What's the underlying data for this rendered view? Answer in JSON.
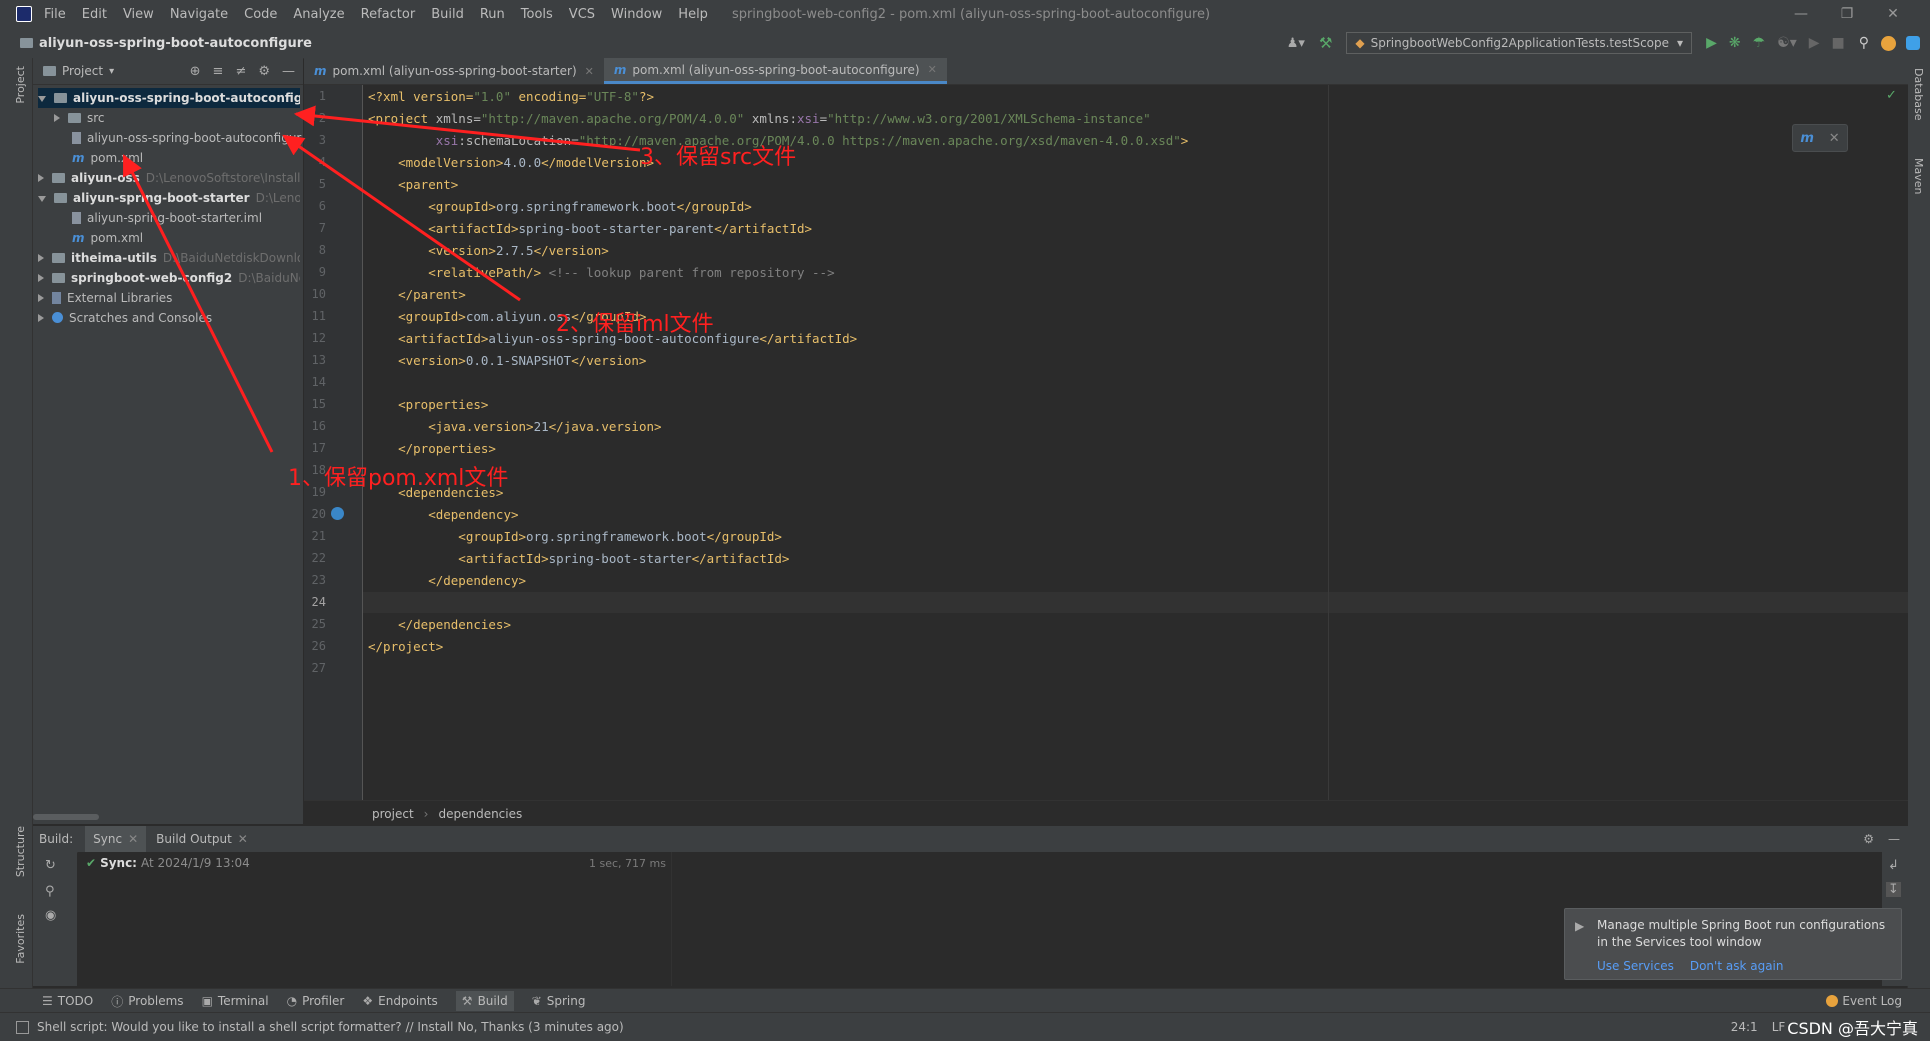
{
  "app": {
    "menu": [
      "File",
      "Edit",
      "View",
      "Navigate",
      "Code",
      "Analyze",
      "Refactor",
      "Build",
      "Run",
      "Tools",
      "VCS",
      "Window",
      "Help"
    ],
    "window_title": "springboot-web-config2 - pom.xml (aliyun-oss-spring-boot-autoconfigure)"
  },
  "navbar": {
    "breadcrumb": "aliyun-oss-spring-boot-autoconfigure",
    "run_config": "SpringbootWebConfig2ApplicationTests.testScope"
  },
  "left_toolbar": {
    "project": "Project",
    "structure": "Structure",
    "favorites": "Favorites"
  },
  "right_toolbar": {
    "database": "Database",
    "maven": "Maven"
  },
  "project_panel": {
    "title": "Project",
    "tree": [
      {
        "label": "aliyun-oss-spring-boot-autoconfigure",
        "path": "",
        "type": "module",
        "expanded": true,
        "indent": 0
      },
      {
        "label": "src",
        "path": "",
        "type": "folder",
        "expanded": false,
        "indent": 1
      },
      {
        "label": "aliyun-oss-spring-boot-autoconfigur",
        "path": "",
        "type": "iml",
        "indent": 2
      },
      {
        "label": "pom.xml",
        "path": "",
        "type": "maven",
        "indent": 2
      },
      {
        "label": "aliyun-oss",
        "path": "D:\\LenovoSoftstore\\Install\\",
        "type": "module",
        "expanded": false,
        "indent": 0
      },
      {
        "label": "aliyun-spring-boot-starter",
        "path": "D:\\LenovoS",
        "type": "module",
        "expanded": true,
        "indent": 0
      },
      {
        "label": "aliyun-spring-boot-starter.iml",
        "path": "",
        "type": "iml",
        "indent": 2
      },
      {
        "label": "pom.xml",
        "path": "",
        "type": "maven",
        "indent": 2
      },
      {
        "label": "itheima-utils",
        "path": "D:\\BaiduNetdiskDownloa",
        "type": "module",
        "expanded": false,
        "indent": 0
      },
      {
        "label": "springboot-web-config2",
        "path": "D:\\BaiduNetc",
        "type": "module",
        "expanded": false,
        "indent": 0
      },
      {
        "label": "External Libraries",
        "path": "",
        "type": "libs",
        "expanded": false,
        "indent": 0
      },
      {
        "label": "Scratches and Consoles",
        "path": "",
        "type": "scratch",
        "expanded": false,
        "indent": 0
      }
    ]
  },
  "tabs": [
    {
      "label": "pom.xml (aliyun-oss-spring-boot-starter)",
      "active": false
    },
    {
      "label": "pom.xml (aliyun-oss-spring-boot-autoconfigure)",
      "active": true
    }
  ],
  "editor": {
    "lines": [
      [
        [
          "<?xml version=",
          "t"
        ],
        [
          "\"1.0\"",
          "s"
        ],
        [
          " encoding=",
          "t"
        ],
        [
          "\"UTF-8\"",
          "s"
        ],
        [
          "?>",
          "t"
        ]
      ],
      [
        [
          "<project ",
          "t"
        ],
        [
          "xmlns=",
          "a"
        ],
        [
          "\"http://maven.apache.org/POM/4.0.0\"",
          "s"
        ],
        [
          " xmlns:",
          "a"
        ],
        [
          "xsi",
          "nsp"
        ],
        [
          "=",
          "a"
        ],
        [
          "\"http://www.w3.org/2001/XMLSchema-instance\"",
          "s"
        ]
      ],
      [
        [
          "         ",
          "a"
        ],
        [
          "xsi",
          "nsp"
        ],
        [
          ":schemaLocation=",
          "a"
        ],
        [
          "\"http://maven.apache.org/POM/4.0.0 https://maven.apache.org/xsd/maven-4.0.0.xsd\"",
          "s"
        ],
        [
          ">",
          "t"
        ]
      ],
      [
        [
          "    <modelVersion>",
          "t"
        ],
        [
          "4.0.0",
          "p"
        ],
        [
          "</modelVersion>",
          "t"
        ]
      ],
      [
        [
          "    <parent>",
          "t"
        ]
      ],
      [
        [
          "        <groupId>",
          "t"
        ],
        [
          "org.springframework.boot",
          "p"
        ],
        [
          "</groupId>",
          "t"
        ]
      ],
      [
        [
          "        <artifactId>",
          "t"
        ],
        [
          "spring-boot-starter-parent",
          "p"
        ],
        [
          "</artifactId>",
          "t"
        ]
      ],
      [
        [
          "        <version>",
          "t"
        ],
        [
          "2.7.5",
          "p"
        ],
        [
          "</version>",
          "t"
        ]
      ],
      [
        [
          "        <relativePath/>",
          "t"
        ],
        [
          " <!-- lookup parent from repository -->",
          "c"
        ]
      ],
      [
        [
          "    </parent>",
          "t"
        ]
      ],
      [
        [
          "    <groupId>",
          "t"
        ],
        [
          "com.aliyun.oss",
          "p"
        ],
        [
          "</groupId>",
          "t"
        ]
      ],
      [
        [
          "    <artifactId>",
          "t"
        ],
        [
          "aliyun-oss-spring-boot-autoconfigure",
          "p"
        ],
        [
          "</artifactId>",
          "t"
        ]
      ],
      [
        [
          "    <version>",
          "t"
        ],
        [
          "0.0.1-SNAPSHOT",
          "p"
        ],
        [
          "</version>",
          "t"
        ]
      ],
      [],
      [
        [
          "    <properties>",
          "t"
        ]
      ],
      [
        [
          "        <java.version>",
          "t"
        ],
        [
          "21",
          "p"
        ],
        [
          "</java.version>",
          "t"
        ]
      ],
      [
        [
          "    </properties>",
          "t"
        ]
      ],
      [],
      [
        [
          "    <dependencies>",
          "t"
        ]
      ],
      [
        [
          "        <dependency>",
          "t"
        ]
      ],
      [
        [
          "            <groupId>",
          "t"
        ],
        [
          "org.springframework.boot",
          "p"
        ],
        [
          "</groupId>",
          "t"
        ]
      ],
      [
        [
          "            <artifactId>",
          "t"
        ],
        [
          "spring-boot-starter",
          "p"
        ],
        [
          "</artifactId>",
          "t"
        ]
      ],
      [
        [
          "        </dependency>",
          "t"
        ]
      ],
      [],
      [
        [
          "    </dependencies>",
          "t"
        ]
      ],
      [
        [
          "</project>",
          "t"
        ]
      ],
      []
    ],
    "breadcrumbs": [
      "project",
      "dependencies"
    ]
  },
  "annotations": {
    "a1": "1、保留pom.xml文件",
    "a2": "2、保留iml文件",
    "a3": "3、保留src文件"
  },
  "build": {
    "label": "Build:",
    "tabs": [
      "Sync",
      "Build Output"
    ],
    "sync_label": "Sync:",
    "sync_time": "At 2024/1/9 13:04",
    "duration": "1 sec, 717 ms"
  },
  "notification": {
    "text": "Manage multiple Spring Boot run configurations in the Services tool window",
    "link1": "Use Services",
    "link2": "Don't ask again"
  },
  "toolwindows": [
    "TODO",
    "Problems",
    "Terminal",
    "Profiler",
    "Endpoints",
    "Build",
    "Spring"
  ],
  "event_log": "Event Log",
  "status": {
    "message": "Shell script: Would you like to install a shell script formatter? // Install   No, Thanks (3 minutes ago)",
    "position": "24:1",
    "line_sep": "LF",
    "watermark": "CSDN @吾大宁真"
  },
  "colors": {
    "accent": "#4a88c7",
    "annotation": "#ff2020",
    "run": "#59a869"
  }
}
